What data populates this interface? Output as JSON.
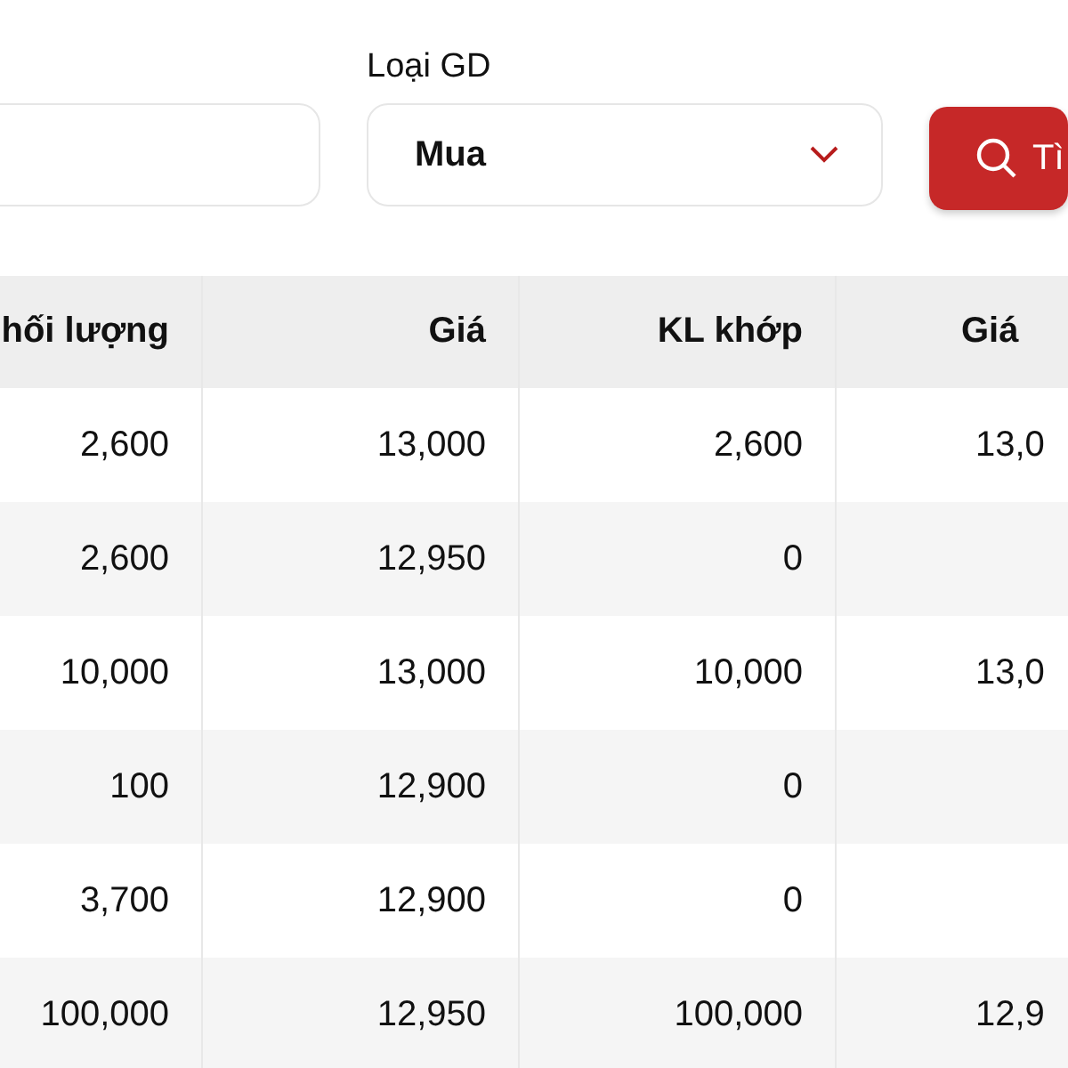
{
  "filters": {
    "type_label": "Loại GD",
    "type_select": {
      "value": "Mua"
    },
    "search_button": {
      "label": "Tì"
    }
  },
  "table": {
    "columns": [
      "hối lượng",
      "Giá",
      "KL khớp",
      "Giá"
    ],
    "rows": [
      [
        "2,600",
        "13,000",
        "2,600",
        "13,0"
      ],
      [
        "2,600",
        "12,950",
        "0",
        ""
      ],
      [
        "10,000",
        "13,000",
        "10,000",
        "13,0"
      ],
      [
        "100",
        "12,900",
        "0",
        ""
      ],
      [
        "3,700",
        "12,900",
        "0",
        ""
      ],
      [
        "100,000",
        "12,950",
        "100,000",
        "12,9"
      ]
    ]
  }
}
